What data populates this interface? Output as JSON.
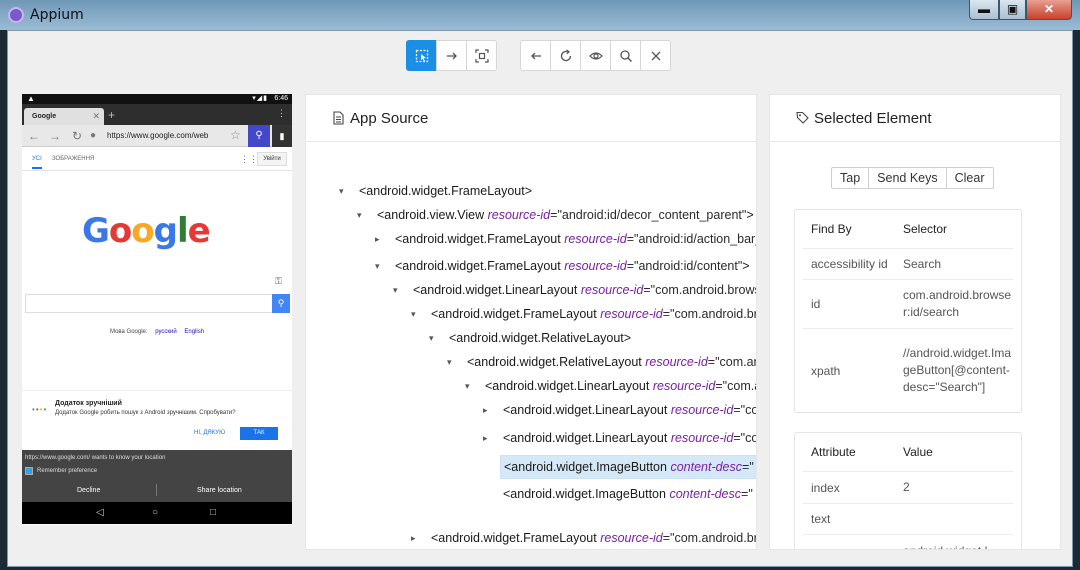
{
  "window": {
    "title": "Appium",
    "min": "▬",
    "max": "▣",
    "close": "✕"
  },
  "device": {
    "status_time": "6:46",
    "tab_title": "Google",
    "url": "https://www.google.com/web",
    "nav_all": "УСІ",
    "nav_images": "ЗОБРАЖЕННЯ",
    "login": "Увійти",
    "logo": [
      "G",
      "o",
      "o",
      "g",
      "l",
      "e"
    ],
    "lang_label": "Мова Google:",
    "lang1": "русский",
    "lang2": "English",
    "promo_title": "Додаток зручніший",
    "promo_text": "Додаток Google робить пошук з Android зручнішим. Спробувати?",
    "promo_no": "НІ, ДЯКУЮ",
    "promo_yes": "ТАК",
    "loc_msg": "https://www.google.com/ wants to know your location",
    "remember": "Remember preference",
    "decline": "Decline",
    "share": "Share location"
  },
  "source": {
    "title": "App Source",
    "nodes": [
      {
        "arrow": "▾",
        "tag": "<android.widget.FrameLayout>",
        "attr": "",
        "val": "",
        "close": ""
      },
      {
        "arrow": "▾",
        "tag": "<android.view.View ",
        "attr": "resource-id",
        "val": "=\"android:id/decor_content_parent\"",
        "close": ">"
      },
      {
        "arrow": "▸",
        "tag": "<android.widget.FrameLayout ",
        "attr": "resource-id",
        "val": "=\"android:id/action_bar_",
        "close": ""
      },
      {
        "arrow": "▾",
        "tag": "<android.widget.FrameLayout ",
        "attr": "resource-id",
        "val": "=\"android:id/content\"",
        "close": ">"
      },
      {
        "arrow": "▾",
        "tag": "<android.widget.LinearLayout ",
        "attr": "resource-id",
        "val": "=\"com.android.brows",
        "close": ""
      },
      {
        "arrow": "▾",
        "tag": "<android.widget.FrameLayout ",
        "attr": "resource-id",
        "val": "=\"com.android.br",
        "close": ""
      },
      {
        "arrow": "▾",
        "tag": "<android.widget.RelativeLayout>",
        "attr": "",
        "val": "",
        "close": ""
      },
      {
        "arrow": "▾",
        "tag": "<android.widget.RelativeLayout ",
        "attr": "resource-id",
        "val": "=\"com.an",
        "close": ""
      },
      {
        "arrow": "▾",
        "tag": "<android.widget.LinearLayout ",
        "attr": "resource-id",
        "val": "=\"com.a",
        "close": ""
      },
      {
        "arrow": "▸",
        "tag": "<android.widget.LinearLayout ",
        "attr": "resource-id",
        "val": "=\"co",
        "close": ""
      },
      {
        "arrow": "▸",
        "tag": "<android.widget.LinearLayout ",
        "attr": "resource-id",
        "val": "=\"co",
        "close": ""
      },
      {
        "arrow": "",
        "tag": "<android.widget.ImageButton ",
        "attr": "content-desc",
        "val": "=\"",
        "close": ""
      },
      {
        "arrow": "",
        "tag": "<android.widget.ImageButton ",
        "attr": "content-desc",
        "val": "=\"",
        "close": ""
      },
      {
        "arrow": "▸",
        "tag": "<android.widget.FrameLayout ",
        "attr": "resource-id",
        "val": "=\"com.android.br",
        "close": ""
      }
    ]
  },
  "selected": {
    "title": "Selected Element",
    "actions": [
      "Tap",
      "Send Keys",
      "Clear"
    ],
    "find_head": [
      "Find By",
      "Selector"
    ],
    "find_rows": [
      [
        "accessibility id",
        "Search"
      ],
      [
        "id",
        "com.android.browser:id/search"
      ],
      [
        "xpath",
        "//android.widget.ImageButton[@content-desc=\"Search\"]"
      ]
    ],
    "attr_head": [
      "Attribute",
      "Value"
    ],
    "attr_rows": [
      [
        "index",
        "2"
      ],
      [
        "text",
        ""
      ],
      [
        "",
        "android.widget.I"
      ]
    ]
  }
}
